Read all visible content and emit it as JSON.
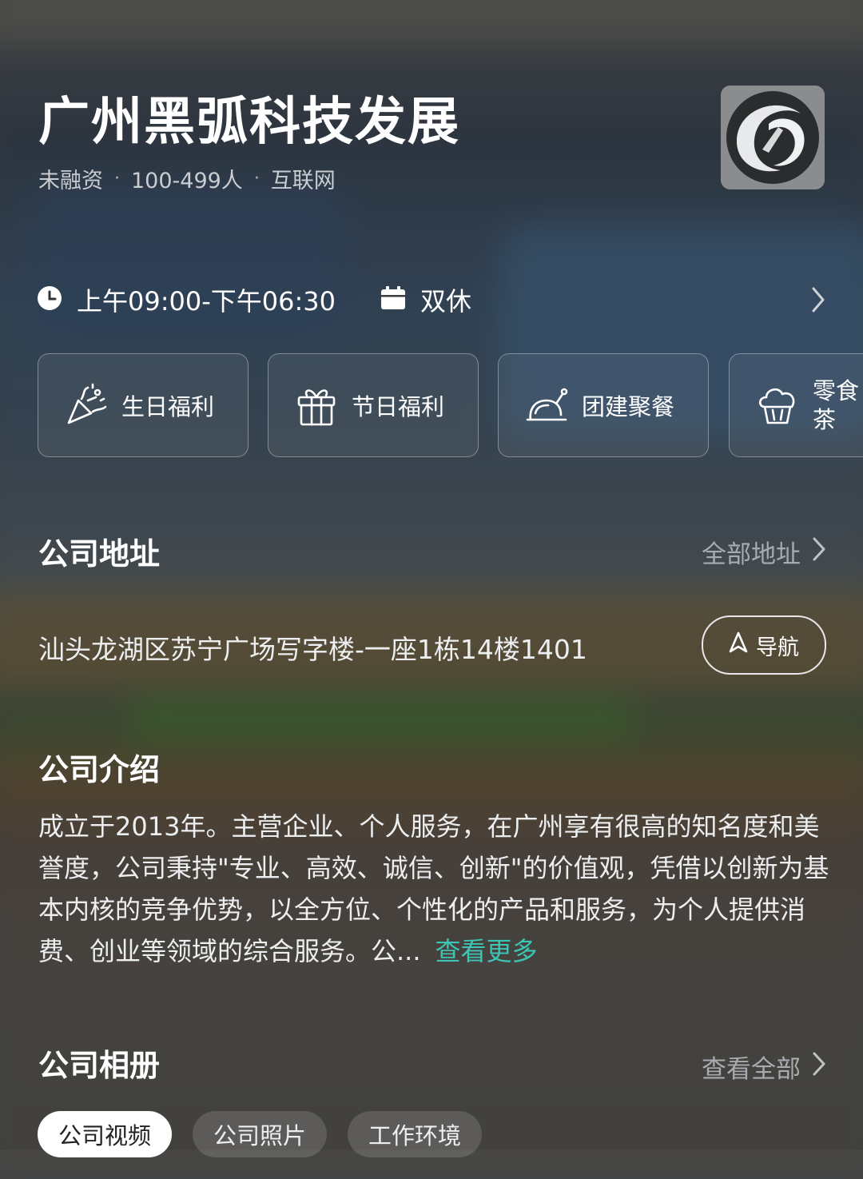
{
  "company": {
    "name": "广州黑弧科技发展",
    "meta": [
      "未融资",
      "100-499人",
      "互联网"
    ]
  },
  "schedule": {
    "hours": "上午09:00-下午06:30",
    "rest": "双休"
  },
  "benefits": [
    {
      "label": "生日福利",
      "icon": "party-popper-icon"
    },
    {
      "label": "节日福利",
      "icon": "gift-icon"
    },
    {
      "label": "团建聚餐",
      "icon": "roast-dish-icon"
    },
    {
      "label": "零食茶",
      "icon": "cupcake-icon"
    }
  ],
  "address_section": {
    "title": "公司地址",
    "link": "全部地址",
    "address": "汕头龙湖区苏宁广场写字楼-一座1栋14楼1401",
    "nav_label": "导航"
  },
  "intro_section": {
    "title": "公司介绍",
    "text": "成立于2013年。主营企业、个人服务，在广州享有很高的知名度和美誉度，公司秉持\"专业、高效、诚信、创新\"的价值观，凭借以创新为基本内核的竞争优势，以全方位、个性化的产品和服务，为个人提供消费、创业等领域的综合服务。公...",
    "more": "查看更多"
  },
  "album_section": {
    "title": "公司相册",
    "link": "查看全部",
    "tabs": [
      "公司视频",
      "公司照片",
      "工作环境"
    ]
  },
  "colors": {
    "accent": "#3cc4b4",
    "muted": "#a8abaf"
  }
}
